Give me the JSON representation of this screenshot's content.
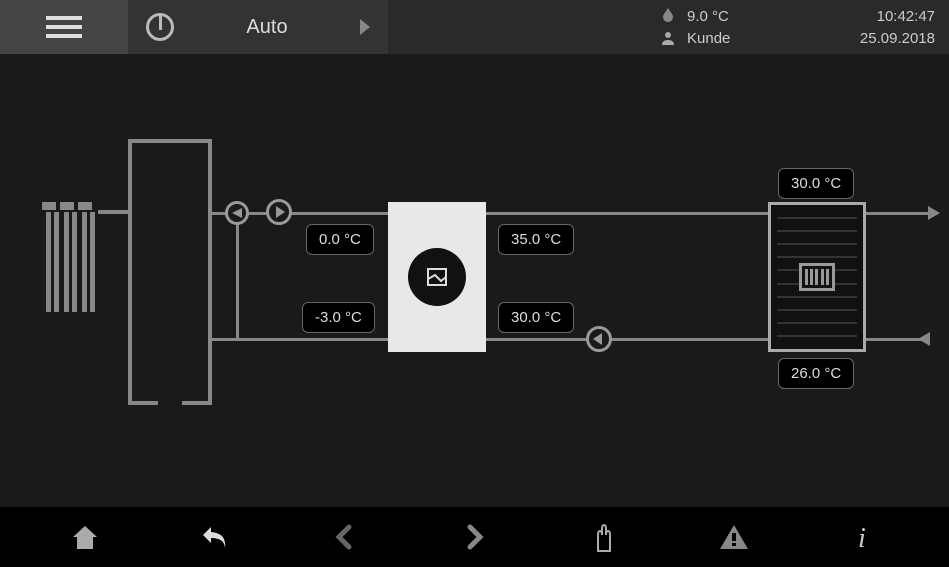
{
  "header": {
    "mode_label": "Auto",
    "outdoor_temp": "9.0 °C",
    "user": "Kunde",
    "time": "10:42:47",
    "date": "25.09.2018"
  },
  "temps": {
    "source_flow": "0.0 °C",
    "source_return": "-3.0 °C",
    "heating_flow_out": "35.0 °C",
    "heating_return_in": "30.0 °C",
    "radiator_top": "30.0 °C",
    "radiator_bottom": "26.0 °C"
  }
}
